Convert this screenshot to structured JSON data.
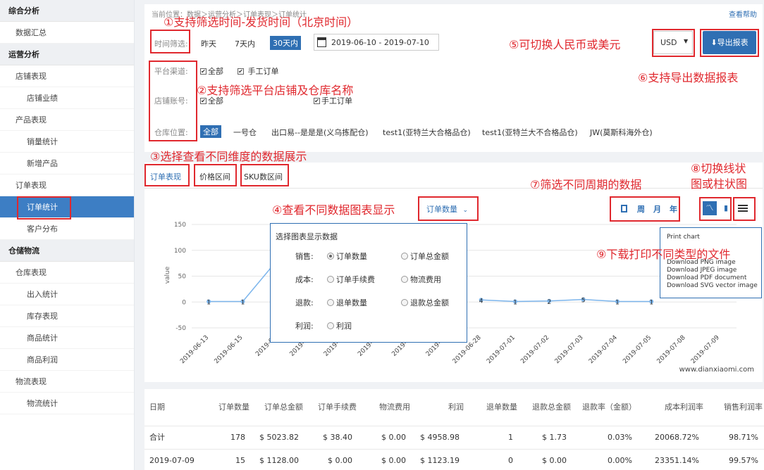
{
  "sidebar": {
    "sections": [
      {
        "label": "综合分析",
        "type": "cat"
      },
      {
        "label": "数据汇总",
        "type": "item"
      },
      {
        "label": "运营分析",
        "type": "cat"
      },
      {
        "label": "店铺表现",
        "type": "item"
      },
      {
        "label": "店铺业绩",
        "type": "sub"
      },
      {
        "label": "产品表现",
        "type": "item"
      },
      {
        "label": "销量统计",
        "type": "sub"
      },
      {
        "label": "新增产品",
        "type": "sub"
      },
      {
        "label": "订单表现",
        "type": "item"
      },
      {
        "label": "订单统计",
        "type": "sub",
        "active": true
      },
      {
        "label": "客户分布",
        "type": "sub"
      },
      {
        "label": "仓储物流",
        "type": "cat"
      },
      {
        "label": "仓库表现",
        "type": "item"
      },
      {
        "label": "出入统计",
        "type": "sub"
      },
      {
        "label": "库存表现",
        "type": "sub"
      },
      {
        "label": "商品统计",
        "type": "sub"
      },
      {
        "label": "商品利润",
        "type": "sub"
      },
      {
        "label": "物流表现",
        "type": "item"
      },
      {
        "label": "物流统计",
        "type": "sub"
      }
    ]
  },
  "breadcrumb": "当前位置：数据＞运营分析＞订单表现＞订单统计",
  "help_link": "查看帮助",
  "filters": {
    "time_label": "时间筛选:",
    "time_options": [
      "昨天",
      "7天内",
      "30天内"
    ],
    "date_range": "2019-06-10 - 2019-07-10",
    "channel_label": "平台渠道:",
    "channel_options": [
      "全部",
      "手工订单"
    ],
    "store_label": "店铺账号:",
    "store_options": [
      "全部",
      "手工订单"
    ],
    "warehouse_label": "仓库位置:",
    "warehouse_options": [
      "全部",
      "一号仓",
      "出口易--是是是(义乌拣配仓)",
      "test1(亚特兰大合格品仓)",
      "test1(亚特兰大不合格品仓)",
      "JW(莫斯科海外仓)"
    ],
    "currency": "USD",
    "export_label": "导出报表"
  },
  "annotations": {
    "a1": "①支持筛选时间-发货时间（北京时间）",
    "a2": "②支持筛选平台店铺及仓库名称",
    "a3": "③选择查看不同维度的数据展示",
    "a4": "④查看不同数据图表显示",
    "a5": "⑤可切换人民币或美元",
    "a6": "⑥支持导出数据报表",
    "a7": "⑦筛选不同周期的数据",
    "a8_l1": "⑧切换线状",
    "a8_l2": "图或柱状图",
    "a9": "⑨下载打印不同类型的文件"
  },
  "tabs": [
    "订单表现",
    "价格区间",
    "SKU数区间"
  ],
  "metric_dropdown": "订单数量",
  "period_buttons": [
    "日",
    "周",
    "月",
    "年"
  ],
  "metric_popup": {
    "title": "选择图表显示数据",
    "groups": [
      {
        "label": "销售:",
        "options": [
          "订单数量",
          "订单总金额"
        ],
        "selected": 0
      },
      {
        "label": "成本:",
        "options": [
          "订单手续费",
          "物流费用"
        ],
        "selected": -1
      },
      {
        "label": "退款:",
        "options": [
          "退单数量",
          "退款总金额"
        ],
        "selected": -1
      },
      {
        "label": "利润:",
        "options": [
          "利润"
        ],
        "selected": -1
      }
    ]
  },
  "export_menu": {
    "items": [
      "Print chart",
      "Download PNG image",
      "Download JPEG image",
      "Download PDF document",
      "Download SVG vector image"
    ]
  },
  "watermark": "www.dianxiaomi.com",
  "chart_data": {
    "type": "line",
    "ylabel": "value",
    "ylim": [
      -50,
      150
    ],
    "yticks": [
      -50,
      0,
      50,
      100,
      150
    ],
    "x": [
      "2019-06-13",
      "2019-06-15",
      "2019-06-17",
      "2019-06-19",
      "2019-06-20",
      "2019-06-21",
      "2019-06-24",
      "2019-06-26",
      "2019-06-28",
      "2019-07-01",
      "2019-07-02",
      "2019-07-03",
      "2019-07-04",
      "2019-07-05",
      "2019-07-08",
      "2019-07-09"
    ],
    "x_visible_labels": [
      "2019-06-13",
      "2019-06-15",
      "2019-06",
      "2019-06",
      "2019-06",
      "2019-06",
      "2019-06",
      "2019-06",
      "2019-06-28",
      "2019-07-01",
      "2019-07-02",
      "2019-07-03",
      "2019-07-04",
      "2019-07-05",
      "2019-07-08",
      "2019-07-09"
    ],
    "series": [
      {
        "values": [
          1,
          1,
          80,
          null,
          null,
          null,
          null,
          null,
          4,
          1,
          2,
          5,
          1,
          1,
          null,
          null
        ],
        "color": "#7cb5ec"
      }
    ],
    "point_labels": [
      "1",
      "1",
      "",
      "",
      "",
      "",
      "",
      "",
      "4",
      "1",
      "2",
      "5",
      "1",
      "1",
      "",
      ""
    ],
    "grid": true
  },
  "table": {
    "columns": [
      "日期",
      "订单数量",
      "订单总金额",
      "订单手续费",
      "物流费用",
      "利润",
      "退单数量",
      "退款总金额",
      "退款率（金额）",
      "成本利润率",
      "销售利润率"
    ],
    "rows": [
      [
        "合计",
        "178",
        "$ 5023.82",
        "$ 38.40",
        "$ 0.00",
        "$ 4958.98",
        "1",
        "$ 1.73",
        "0.03%",
        "20068.72%",
        "98.71%"
      ],
      [
        "2019-07-09",
        "15",
        "$ 1128.00",
        "$ 0.00",
        "$ 0.00",
        "$ 1123.19",
        "0",
        "$ 0.00",
        "0.00%",
        "23351.14%",
        "99.57%"
      ]
    ]
  },
  "colors": {
    "accent": "#2f6fb3",
    "annotation": "#e0282e",
    "line": "#7cb5ec"
  }
}
